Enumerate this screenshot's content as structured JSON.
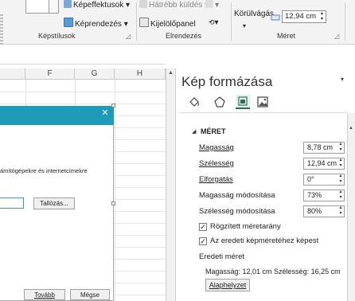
{
  "ribbon": {
    "image_effects": "Képeffektusok",
    "image_layout": "Képrendezés",
    "bring_back": "Hátrébb küldés",
    "selection_pane": "Kijelölőpanel",
    "crop": "Körülvágás",
    "height_value": "12,94 cm",
    "groups": {
      "styles": "Képstílusok",
      "arrange": "Elrendezés",
      "size": "Méret"
    }
  },
  "sheet": {
    "columns": [
      "F",
      "G",
      "H"
    ]
  },
  "dialog": {
    "body_text": "ámítógépekre és internetcímekre",
    "browse_button": "Tallózás...",
    "next_button": "Tovább",
    "cancel_button": "Mégse"
  },
  "pane": {
    "title": "Kép formázása",
    "section": "MÉRET",
    "fields": [
      {
        "label": "Magasság",
        "value": "8,78 cm"
      },
      {
        "label": "Szélesség",
        "value": "12,94 cm"
      },
      {
        "label": "Elforgatás",
        "value": "0°"
      },
      {
        "label": "Magasság módosítása",
        "value": "73%"
      },
      {
        "label": "Szélesség módosítása",
        "value": "80%"
      }
    ],
    "lock_aspect": "Rögzített méretarány",
    "relative_to_original": "Az eredeti képméretéhez képest",
    "original_size_heading": "Eredeti méret",
    "original_size_text": "Magasság:  12,01 cm  Szélesség:  16,25 cm",
    "reset_button": "Alaphelyzet"
  },
  "colors": {
    "accent": "#1e9bb8",
    "pane_bg": "#ffffff",
    "sheet_bg": "#ffffff"
  }
}
